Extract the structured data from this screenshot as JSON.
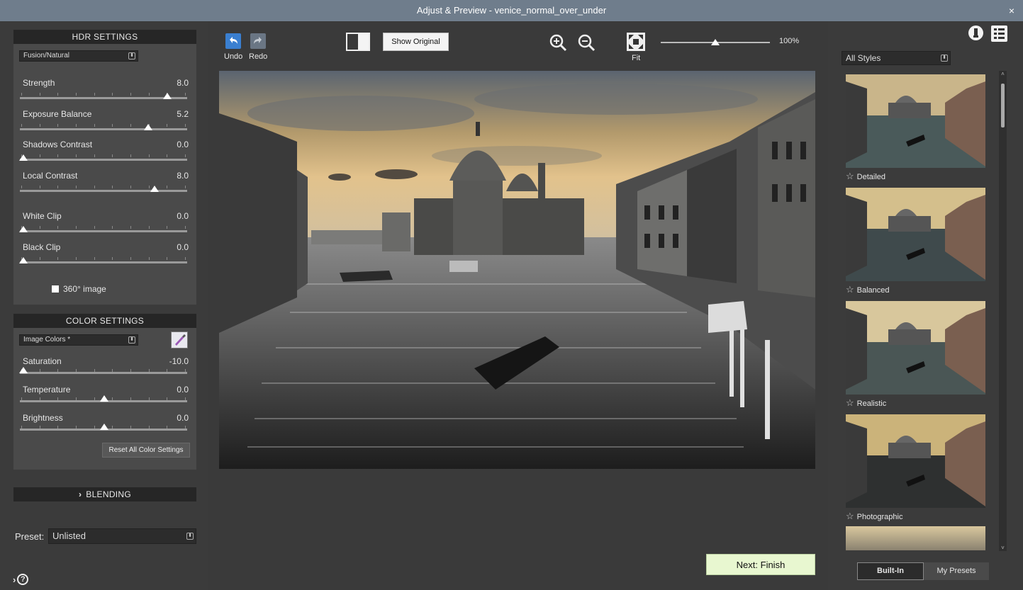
{
  "window": {
    "title": "Adjust & Preview - venice_normal_over_under",
    "close_glyph": "×"
  },
  "hdr": {
    "header": "HDR SETTINGS",
    "method": "Fusion/Natural",
    "sliders": [
      {
        "label": "Strength",
        "value": "8.0",
        "level": 0.88
      },
      {
        "label": "Exposure Balance",
        "value": "5.2",
        "level": 0.76
      },
      {
        "label": "Shadows Contrast",
        "value": "0.0",
        "level": 0.0
      },
      {
        "label": "Local Contrast",
        "value": "8.0",
        "level": 0.8
      },
      {
        "label": "White Clip",
        "value": "0.0",
        "level": 0.0
      },
      {
        "label": "Black Clip",
        "value": "0.0",
        "level": 0.0
      }
    ],
    "checkbox_360": "360° image"
  },
  "color": {
    "header": "COLOR SETTINGS",
    "mode": "Image Colors *",
    "sliders": [
      {
        "label": "Saturation",
        "value": "-10.0",
        "level": 0.0
      },
      {
        "label": "Temperature",
        "value": "0.0",
        "level": 0.5
      },
      {
        "label": "Brightness",
        "value": "0.0",
        "level": 0.5
      }
    ],
    "reset": "Reset All Color Settings"
  },
  "blending": {
    "header": "BLENDING",
    "chevron": "›"
  },
  "preset": {
    "label": "Preset:",
    "value": "Unlisted"
  },
  "help_glyph": "?",
  "toolbar": {
    "undo": "Undo",
    "redo": "Redo",
    "show_original": "Show Original",
    "fit": "Fit",
    "zoom_value": "100%",
    "zoom_level": 0.5
  },
  "next": "Next: Finish",
  "styles": {
    "filter": "All Styles",
    "items": [
      {
        "name": "Detailed"
      },
      {
        "name": "Balanced"
      },
      {
        "name": "Realistic"
      },
      {
        "name": "Photographic"
      }
    ],
    "tabs": {
      "builtin": "Built-In",
      "mine": "My Presets"
    }
  },
  "colors": {
    "accent_next": "#e8f7d0",
    "panel": "#4a4a4a",
    "titlebar": "#6f7d8c"
  }
}
